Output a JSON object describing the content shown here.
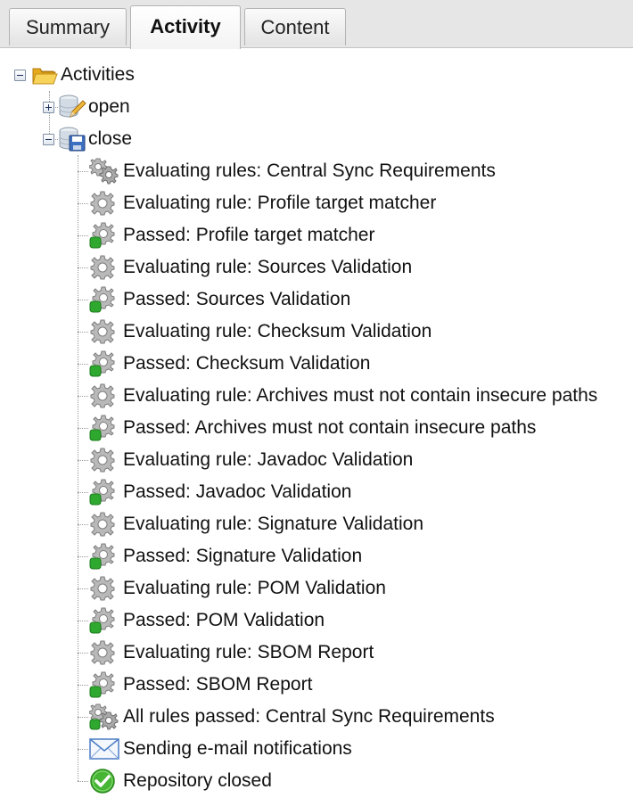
{
  "tabs": [
    {
      "label": "Summary",
      "active": false
    },
    {
      "label": "Activity",
      "active": true
    },
    {
      "label": "Content",
      "active": false
    }
  ],
  "tree": {
    "root": {
      "label": "Activities",
      "icon": "folder-open-icon",
      "expanded": true
    },
    "nodes": [
      {
        "label": "open",
        "icon": "database-edit-icon",
        "expanded": false
      },
      {
        "label": "close",
        "icon": "database-save-icon",
        "expanded": true
      }
    ],
    "events": [
      {
        "label": "Evaluating rules: Central Sync Requirements",
        "icon": "gears-icon"
      },
      {
        "label": "Evaluating rule: Profile target matcher",
        "icon": "gear-icon"
      },
      {
        "label": "Passed: Profile target matcher",
        "icon": "gear-passed-icon"
      },
      {
        "label": "Evaluating rule: Sources Validation",
        "icon": "gear-icon"
      },
      {
        "label": "Passed: Sources Validation",
        "icon": "gear-passed-icon"
      },
      {
        "label": "Evaluating rule: Checksum Validation",
        "icon": "gear-icon"
      },
      {
        "label": "Passed: Checksum Validation",
        "icon": "gear-passed-icon"
      },
      {
        "label": "Evaluating rule: Archives must not contain insecure paths",
        "icon": "gear-icon"
      },
      {
        "label": "Passed: Archives must not contain insecure paths",
        "icon": "gear-passed-icon"
      },
      {
        "label": "Evaluating rule: Javadoc Validation",
        "icon": "gear-icon"
      },
      {
        "label": "Passed: Javadoc Validation",
        "icon": "gear-passed-icon"
      },
      {
        "label": "Evaluating rule: Signature Validation",
        "icon": "gear-icon"
      },
      {
        "label": "Passed: Signature Validation",
        "icon": "gear-passed-icon"
      },
      {
        "label": "Evaluating rule: POM Validation",
        "icon": "gear-icon"
      },
      {
        "label": "Passed: POM Validation",
        "icon": "gear-passed-icon"
      },
      {
        "label": "Evaluating rule: SBOM Report",
        "icon": "gear-icon"
      },
      {
        "label": "Passed: SBOM Report",
        "icon": "gear-passed-icon"
      },
      {
        "label": "All rules passed: Central Sync Requirements",
        "icon": "gears-passed-icon"
      },
      {
        "label": "Sending e-mail notifications",
        "icon": "envelope-icon"
      },
      {
        "label": "Repository closed",
        "icon": "check-circle-icon"
      }
    ]
  },
  "colors": {
    "tab_bg": "#e6e6e6",
    "gear": "#9a9a9a",
    "passed_green": "#2fa82f",
    "folder": "#f3c545",
    "check_green": "#46b533",
    "envelope_blue": "#4a7cc4"
  }
}
